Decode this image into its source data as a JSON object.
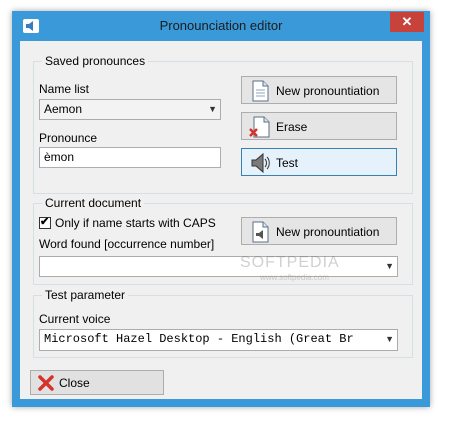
{
  "window": {
    "title": "Pronounciation editor",
    "close_glyph": "✕"
  },
  "saved": {
    "legend": "Saved pronounces",
    "name_list_label": "Name list",
    "name_value": "Aemon",
    "pronounce_label": "Pronounce",
    "pronounce_value": "èmon",
    "new_button": "New pronountiation",
    "erase_button": "Erase",
    "test_button": "Test"
  },
  "document": {
    "legend": "Current document",
    "checkbox_label": "Only if name starts with CAPS",
    "checkbox_checked": true,
    "word_found_label": "Word found [occurrence number]",
    "word_found_value": "",
    "new_button": "New pronountiation"
  },
  "test_param": {
    "legend": "Test parameter",
    "voice_label": "Current voice",
    "voice_value": "Microsoft Hazel Desktop - English (Great Br"
  },
  "close_button": "Close",
  "watermark": {
    "main": "SOFTPEDIA",
    "sub": "www.softpedia.com"
  },
  "icons": {
    "app": "speaker-icon",
    "new": "document-icon",
    "erase": "document-delete-icon",
    "test": "speaker-icon",
    "new_doc": "document-speaker-icon",
    "close": "red-x-icon"
  },
  "colors": {
    "title_bar": "#3a9ad9",
    "close_button": "#c7423b",
    "client": "#f0f0f0"
  }
}
